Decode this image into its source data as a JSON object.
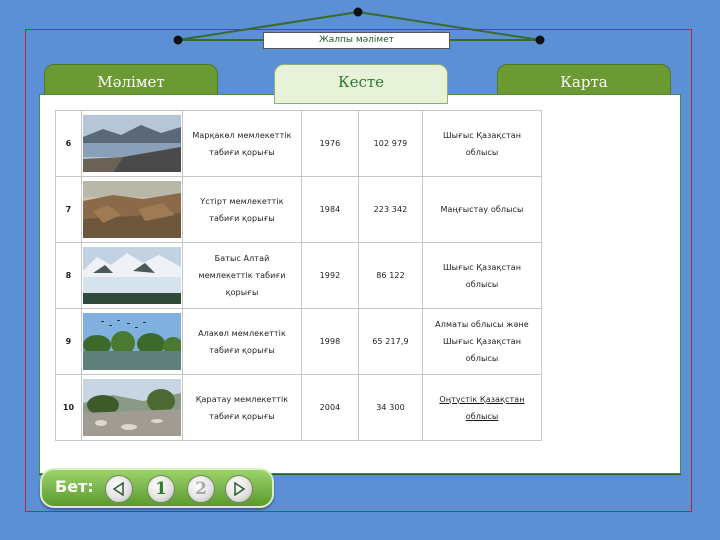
{
  "header": {
    "title": "Жалпы мәлімет"
  },
  "tabs": [
    {
      "label": "Мәлімет"
    },
    {
      "label": "Кесте"
    },
    {
      "label": "Карта"
    }
  ],
  "table": {
    "rows": [
      {
        "num": "6",
        "image": "Markakol lake landscape with mountains and rocky shore",
        "name": "Марқакөл мемлекеттік табиғи қорығы",
        "year": "1976",
        "area": "102 979",
        "region": "Шығыс Қазақстан облысы"
      },
      {
        "num": "7",
        "image": "Ustyurt plateau cliffs and desert",
        "name": "Үстірт мемлекеттік табиғи қорығы",
        "year": "1984",
        "area": "223 342",
        "region": "Маңғыстау облысы"
      },
      {
        "num": "8",
        "image": "Snowy Altai mountains with lake reflection",
        "name": "Батыс Алтай мемлекеттік табиғи қорығы",
        "year": "1992",
        "area": "86 122",
        "region": "Шығыс Қазақстан облысы"
      },
      {
        "num": "9",
        "image": "Alakol wetland with trees and flying birds",
        "name": "Алакөл мемлекеттік табиғи қорығы",
        "year": "1998",
        "area": "65 217,9",
        "region": "Алматы облысы және Шығыс Қазақстан облысы"
      },
      {
        "num": "10",
        "image": "Karatau rocky river valley with trees",
        "name": "Қаратау мемлекеттік табиғи қорығы",
        "year": "2004",
        "area": "34 300",
        "region": "Оңтүстік Қазақстан облысы"
      }
    ]
  },
  "pager": {
    "label": "Бет:",
    "page1": "1",
    "page2": "2"
  }
}
